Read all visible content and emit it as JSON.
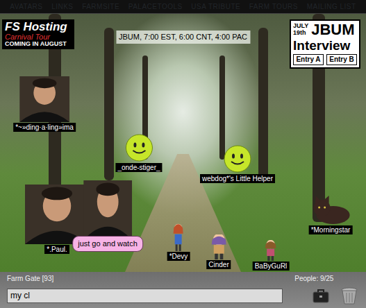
{
  "nav": {
    "links": [
      "AVATARS",
      "LINKS",
      "FARMSITE",
      "PALACETOOLS",
      "USA TRIBUTE",
      "FARM TOURS",
      "MAILING LIST"
    ]
  },
  "room": {
    "logo": {
      "title": "FS Hosting",
      "subtitle": "Carnival Tour",
      "tagline": "COMING IN AUGUST"
    },
    "schedule": "JBUM, 7:00 EST, 6:00 CNT, 4:00 PAC",
    "interview": {
      "date": "JULY",
      "day": "19th",
      "title": "JBUM",
      "subtitle": "Interview",
      "buttons": [
        "Entry A",
        "Entry B"
      ]
    },
    "avatars": [
      {
        "name": "*~»ding·a·ling»ima",
        "kind": "photo"
      },
      {
        "name": "_onde-stiger_",
        "kind": "smiley"
      },
      {
        "name": "webdog*'s Little Helper",
        "kind": "smiley"
      },
      {
        "name": "*Morningstar",
        "kind": "cat"
      },
      {
        "name": "*.Paul.",
        "kind": "photo"
      },
      {
        "bubble": "just go and watch",
        "kind": "photo"
      },
      {
        "name": "*Devy",
        "kind": "sprite"
      },
      {
        "name": "Cinder",
        "kind": "sprite"
      },
      {
        "name": "BaByGuRl",
        "kind": "sprite"
      }
    ]
  },
  "status": {
    "room_name": "Farm Gate [93]",
    "people": "People: 9/25"
  },
  "chat_input": {
    "value": "my cl"
  }
}
